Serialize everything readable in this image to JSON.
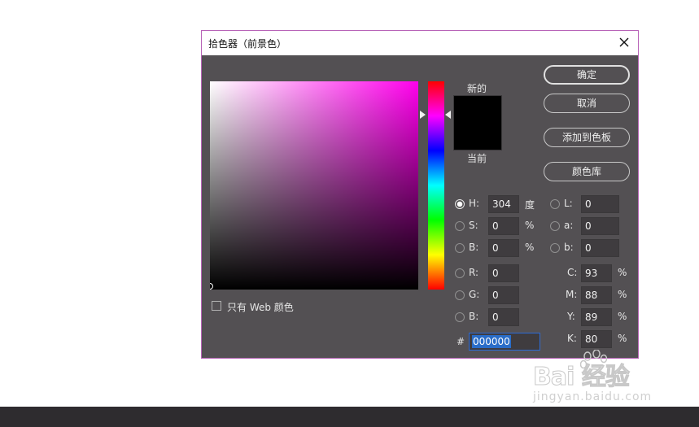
{
  "dialog": {
    "title": "拾色器（前景色）",
    "accent_color": "#b864b8"
  },
  "preview": {
    "new_label": "新的",
    "current_label": "当前",
    "new_color": "#000000",
    "current_color": "#000000"
  },
  "buttons": {
    "ok": "确定",
    "cancel": "取消",
    "add_swatch": "添加到色板",
    "color_library": "颜色库"
  },
  "hsb": {
    "h_label": "H:",
    "h_value": "304",
    "h_unit": "度",
    "s_label": "S:",
    "s_value": "0",
    "s_unit": "%",
    "b_label": "B:",
    "b_value": "0",
    "b_unit": "%"
  },
  "rgb": {
    "r_label": "R:",
    "r_value": "0",
    "g_label": "G:",
    "g_value": "0",
    "b_label": "B:",
    "b_value": "0"
  },
  "lab": {
    "l_label": "L:",
    "l_value": "0",
    "a_label": "a:",
    "a_value": "0",
    "b_label": "b:",
    "b_value": "0"
  },
  "cmyk": {
    "c_label": "C:",
    "c_value": "93",
    "c_unit": "%",
    "m_label": "M:",
    "m_value": "88",
    "m_unit": "%",
    "y_label": "Y:",
    "y_value": "89",
    "y_unit": "%",
    "k_label": "K:",
    "k_value": "80",
    "k_unit": "%"
  },
  "hex": {
    "label": "#",
    "value": "000000"
  },
  "web_only": {
    "label": "只有 Web 颜色",
    "checked": false
  },
  "hue_field_color": "#ff00ec",
  "watermark": {
    "main": "Bai  经验",
    "sub": "jingyan.baidu.com"
  }
}
